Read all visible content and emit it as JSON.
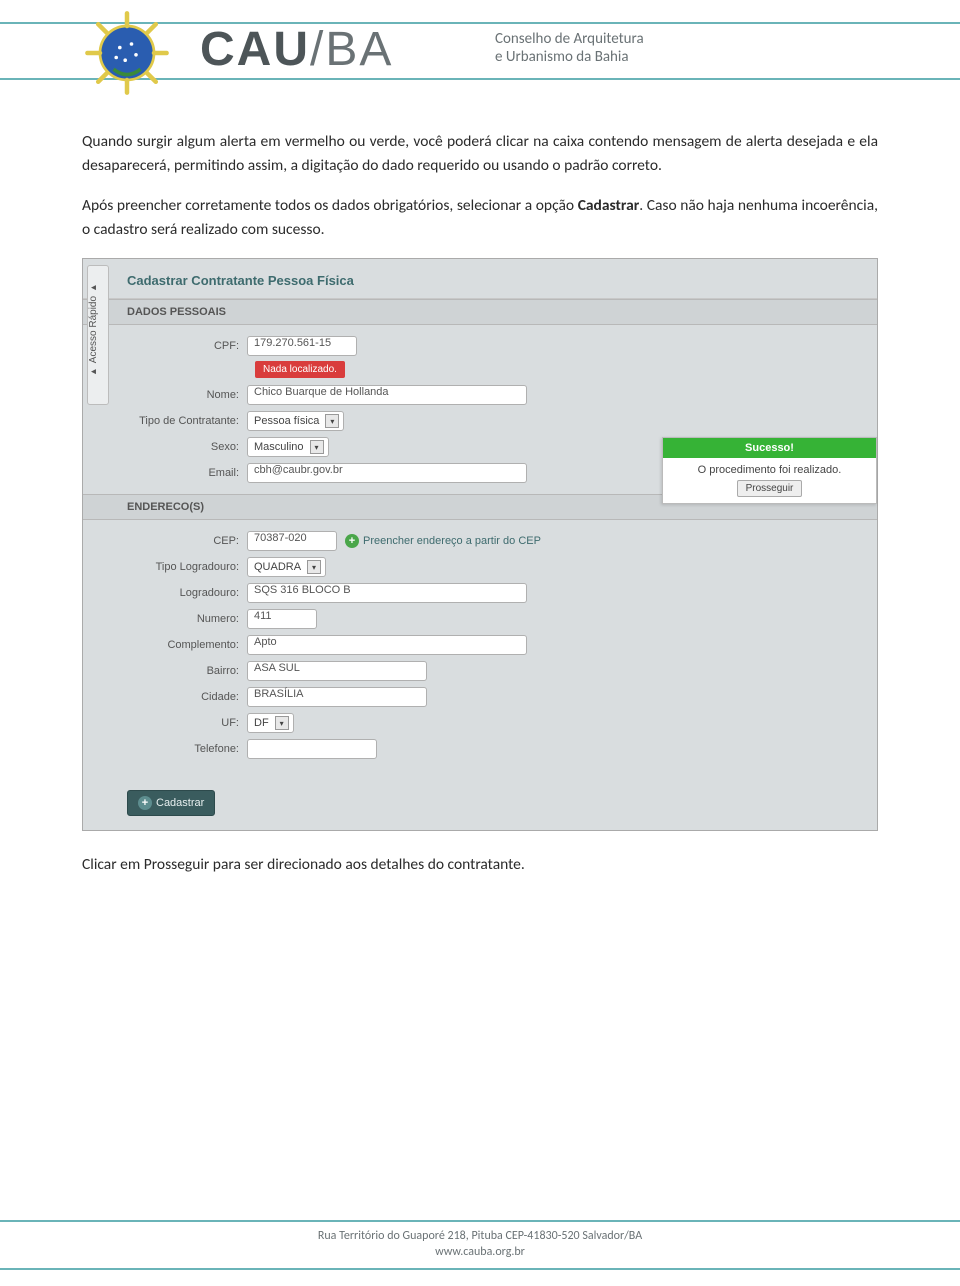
{
  "header": {
    "brand_main": "CAU",
    "brand_suffix": "/BA",
    "brand_sub_line1": "Conselho de Arquitetura",
    "brand_sub_line2": "e Urbanismo da Bahia"
  },
  "body": {
    "p1": "Quando surgir algum alerta em vermelho ou verde, você poderá clicar na caixa contendo mensagem de alerta desejada e ela desaparecerá, permitindo assim, a digitação do dado requerido ou usando o padrão correto.",
    "p2a": "Após preencher corretamente todos os dados obrigatórios, selecionar a opção ",
    "p2b": "Cadastrar",
    "p2c": ". Caso não haja nenhuma incoerência, o cadastro será realizado com sucesso.",
    "p3": "Clicar em Prosseguir para ser direcionado aos detalhes do contratante."
  },
  "app": {
    "acesso_rapido": "Acesso Rápido",
    "title": "Cadastrar Contratante Pessoa Física",
    "section_pessoais": "DADOS PESSOAIS",
    "section_endereco": "ENDERECO(S)",
    "labels": {
      "cpf": "CPF:",
      "nome": "Nome:",
      "tipo_contratante": "Tipo de Contratante:",
      "sexo": "Sexo:",
      "email": "Email:",
      "cep": "CEP:",
      "tipo_logradouro": "Tipo Logradouro:",
      "logradouro": "Logradouro:",
      "numero": "Numero:",
      "complemento": "Complemento:",
      "bairro": "Bairro:",
      "cidade": "Cidade:",
      "uf": "UF:",
      "telefone": "Telefone:"
    },
    "values": {
      "cpf": "179.270.561-15",
      "alert": "Nada localizado.",
      "nome": "Chico Buarque de Hollanda",
      "tipo_contratante": "Pessoa física",
      "sexo": "Masculino",
      "email": "cbh@caubr.gov.br",
      "cep": "70387-020",
      "btn_cep": "Preencher endereço a partir do CEP",
      "tipo_logradouro": "QUADRA",
      "logradouro": "SQS 316 BLOCO B",
      "numero": "411",
      "complemento": "Apto",
      "bairro": "ASA SUL",
      "cidade": "BRASÍLIA",
      "uf": "DF",
      "telefone": ""
    },
    "btn_cadastrar": "Cadastrar",
    "success": {
      "title": "Sucesso!",
      "msg": "O procedimento foi realizado.",
      "btn": "Prosseguir"
    }
  },
  "footer": {
    "line1": "Rua Território do Guaporé 218, Pituba CEP-41830-520 Salvador/BA",
    "line2": "www.cauba.org.br"
  }
}
